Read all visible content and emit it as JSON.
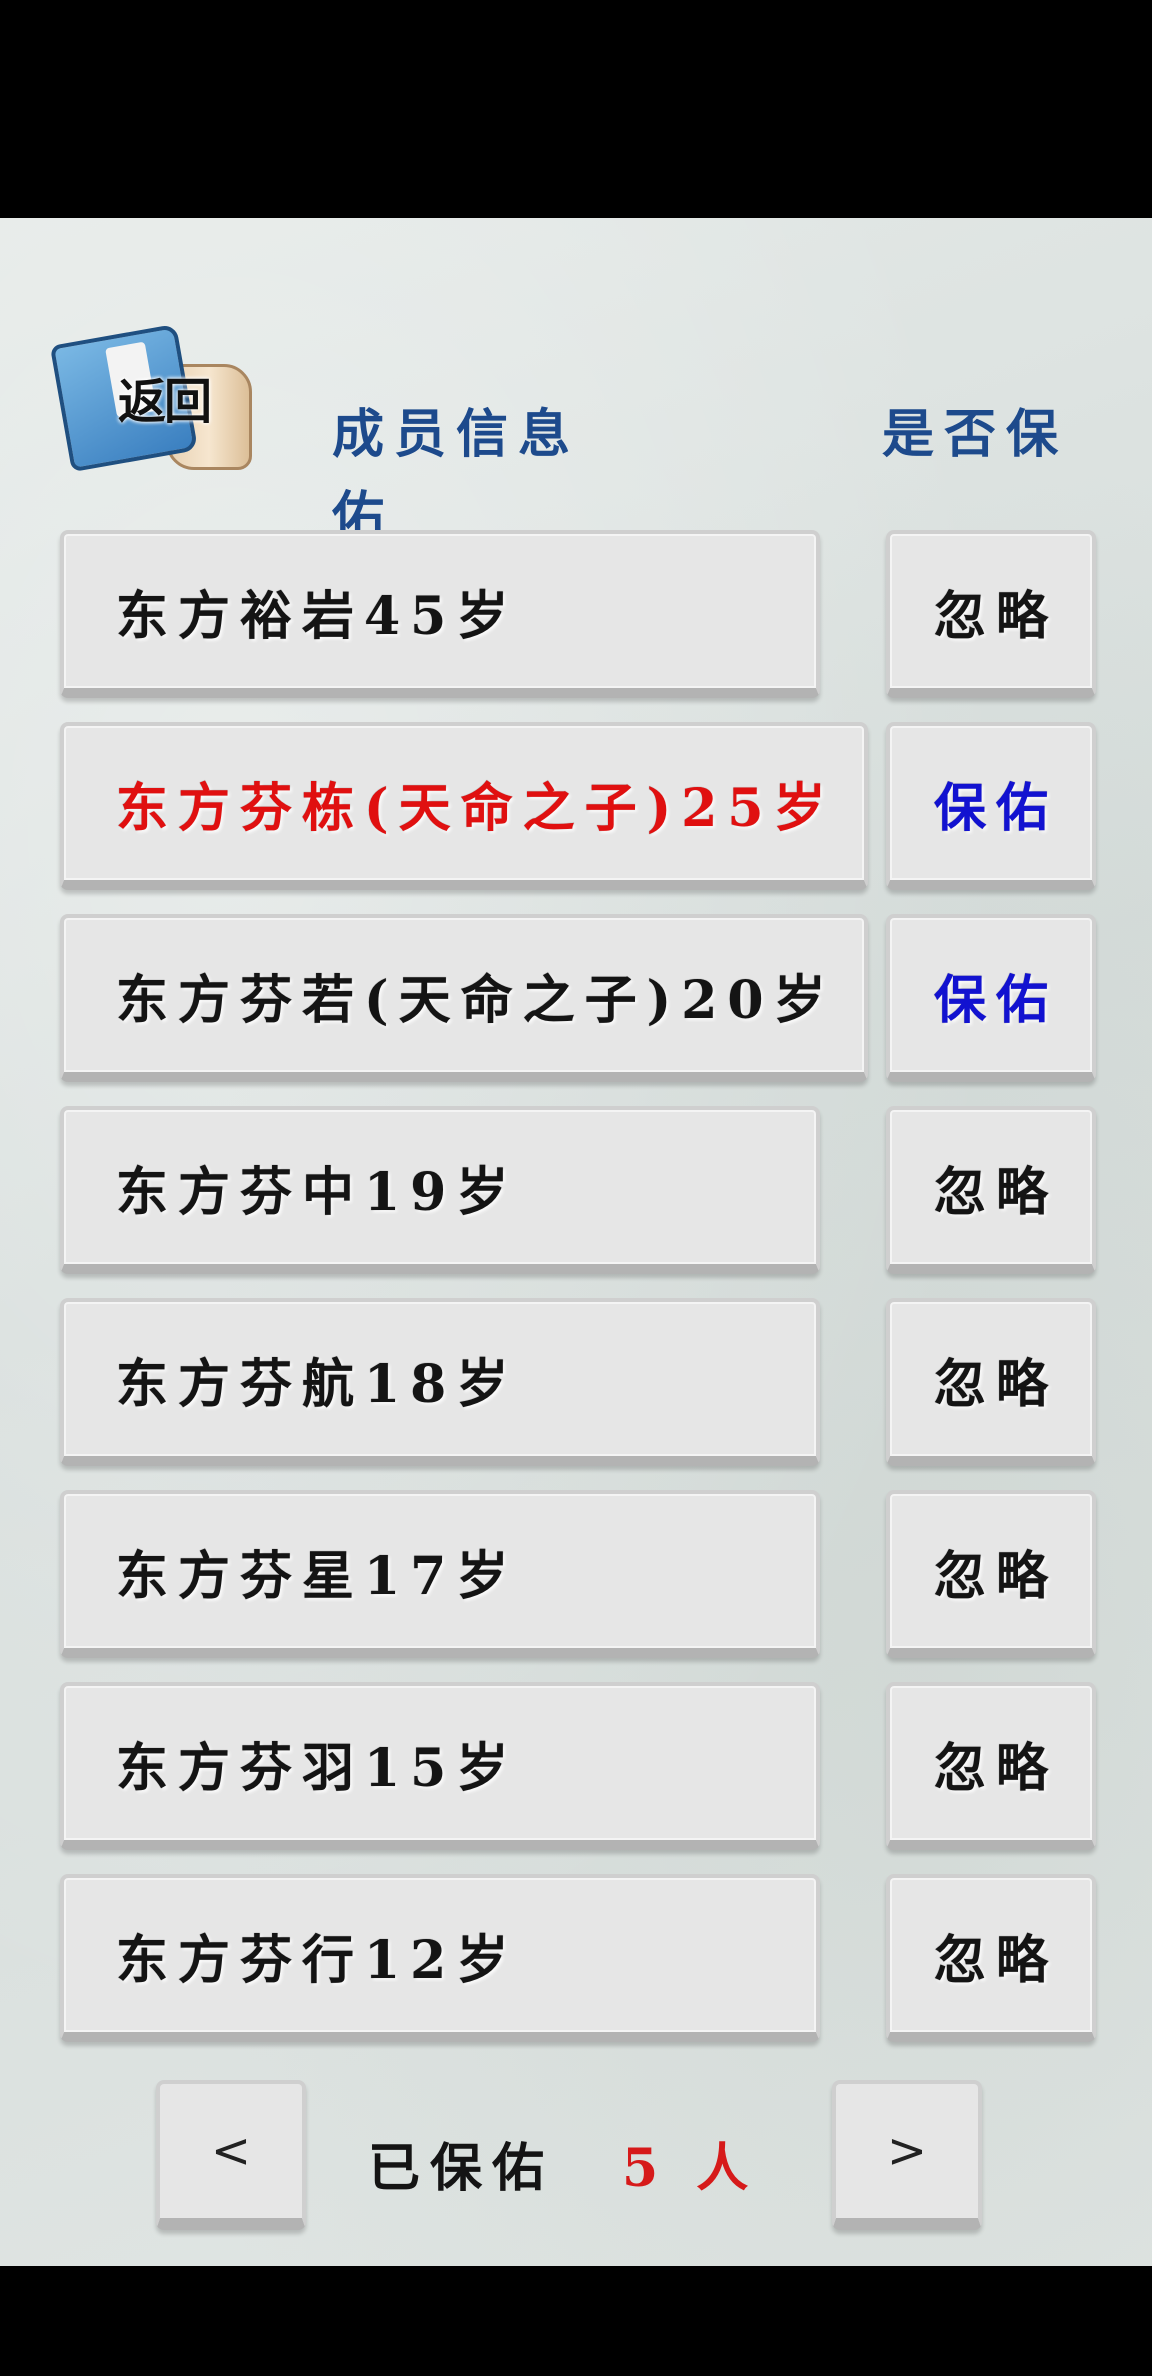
{
  "back_button": {
    "label": "返回"
  },
  "header": {
    "member_info": "成员信息佑",
    "protect_q": "是否保"
  },
  "members": [
    {
      "label": "东方裕岩45岁",
      "action": "忽略",
      "highlight": "none"
    },
    {
      "label": "东方芬栋(天命之子)25岁",
      "action": "保佑",
      "highlight": "red"
    },
    {
      "label": "东方芬若(天命之子)20岁",
      "action": "保佑",
      "highlight": "none"
    },
    {
      "label": "东方芬中19岁",
      "action": "忽略",
      "highlight": "none"
    },
    {
      "label": "东方芬航18岁",
      "action": "忽略",
      "highlight": "none"
    },
    {
      "label": "东方芬星17岁",
      "action": "忽略",
      "highlight": "none"
    },
    {
      "label": "东方芬羽15岁",
      "action": "忽略",
      "highlight": "none"
    },
    {
      "label": "东方芬行12岁",
      "action": "忽略",
      "highlight": "none"
    }
  ],
  "footer": {
    "prev": "<",
    "next": ">",
    "protected_label": "已保佑",
    "protected_count": "5 人"
  },
  "colors": {
    "header": "#1d4a8c",
    "highlight_red": "#e01010",
    "protect_blue": "#1212d0"
  }
}
